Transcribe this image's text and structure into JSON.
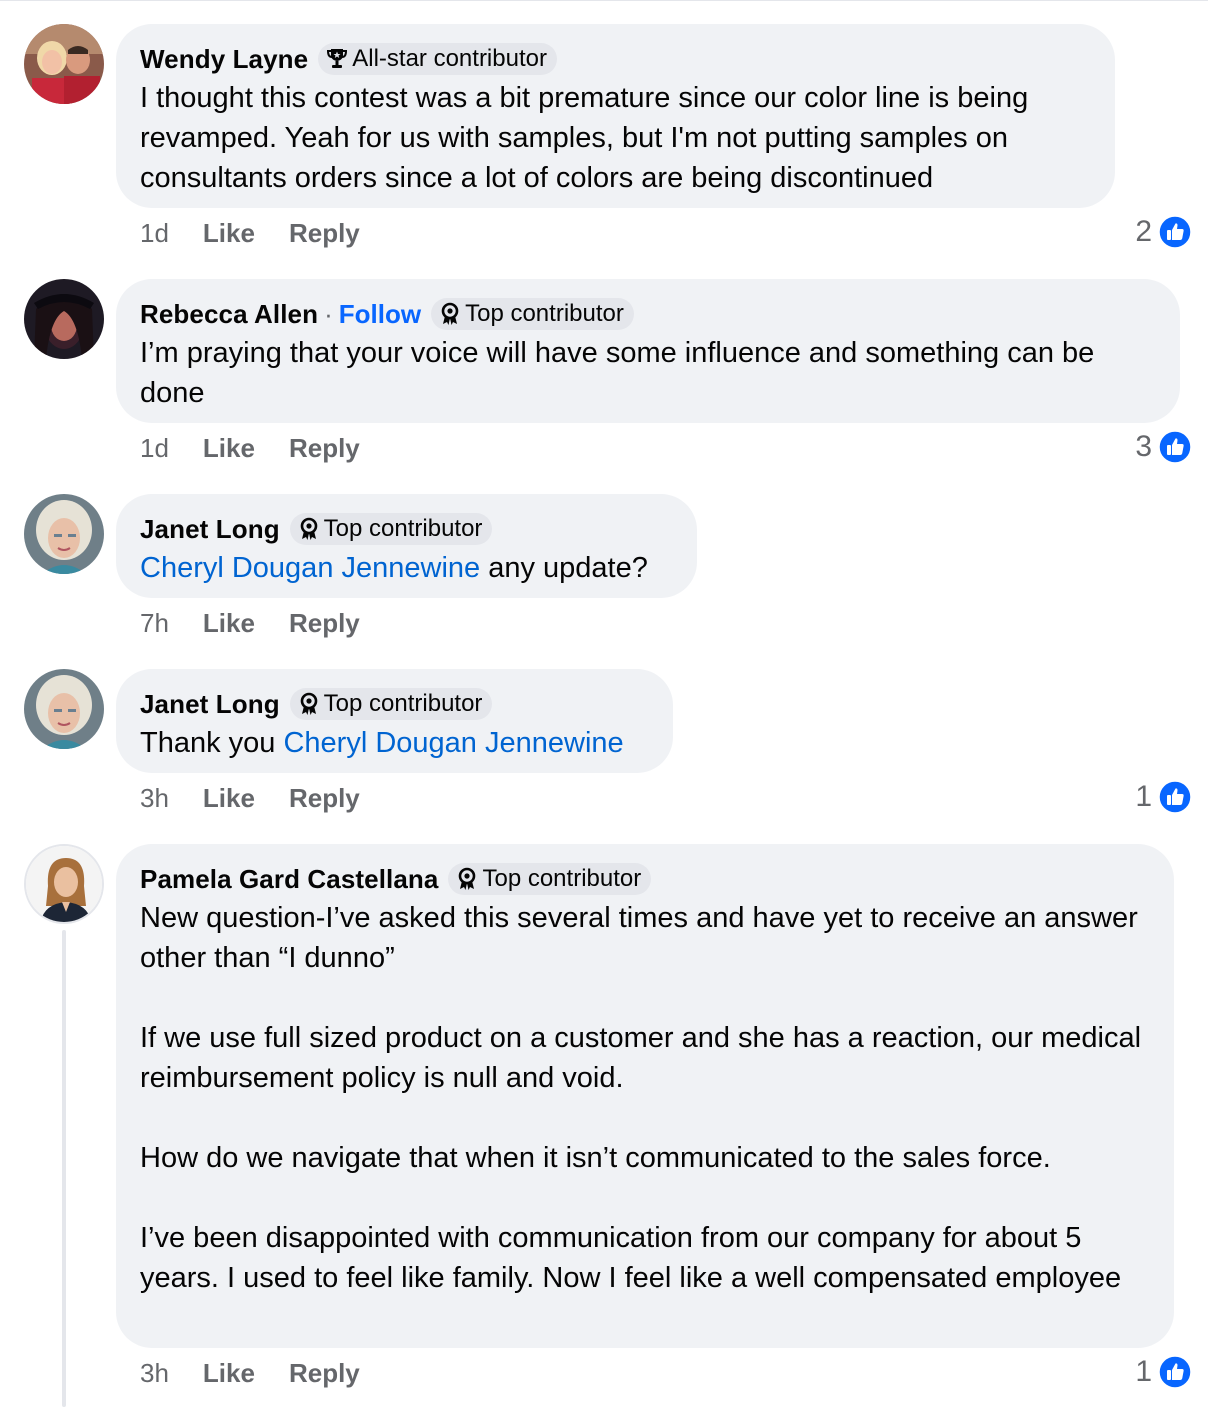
{
  "comments": [
    {
      "author": "Wendy Layne",
      "badge": "All-star contributor",
      "badge_icon": "trophy-icon",
      "text": [
        "I thought this contest was a bit premature since our color line is being revamped. Yeah for us with samples, but I'm not putting samples on consultants orders since a lot of colors are being discontinued"
      ],
      "time": "1d",
      "like_label": "Like",
      "reply_label": "Reply",
      "reaction_count": "2"
    },
    {
      "author": "Rebecca Allen",
      "separator": "·",
      "follow_label": "Follow",
      "badge": "Top contributor",
      "badge_icon": "ribbon-icon",
      "text": [
        "I’m praying that your voice will have some influence and something can be done"
      ],
      "time": "1d",
      "like_label": "Like",
      "reply_label": "Reply",
      "reaction_count": "3"
    },
    {
      "author": "Janet Long",
      "badge": "Top contributor",
      "badge_icon": "ribbon-icon",
      "mention": "Cheryl Dougan Jennewine",
      "text_after": " any update?",
      "time": "7h",
      "like_label": "Like",
      "reply_label": "Reply"
    },
    {
      "author": "Janet Long",
      "badge": "Top contributor",
      "badge_icon": "ribbon-icon",
      "text_before": "Thank you ",
      "mention": "Cheryl Dougan Jennewine",
      "time": "3h",
      "like_label": "Like",
      "reply_label": "Reply",
      "reaction_count": "1"
    },
    {
      "author": "Pamela Gard Castellana",
      "badge": "Top contributor",
      "badge_icon": "ribbon-icon",
      "paragraphs": [
        "New question-I’ve asked this several times and have yet to receive an answer other than “I dunno”",
        "If we use full sized product on a customer and she has a reaction, our medical reimbursement policy is null and void.",
        "How do we navigate that when it isn’t communicated to the sales force.",
        "I’ve been disappointed with communication from our company for about 5 years. I used to feel like family. Now I feel like a well compensated employee"
      ],
      "time": "3h",
      "like_label": "Like",
      "reply_label": "Reply",
      "reaction_count": "1"
    }
  ],
  "colors": {
    "bubble": "#f0f2f5",
    "link_blue": "#0866ff",
    "mention_blue": "#0064d1",
    "meta_gray": "#65676b",
    "like_blue": "#0866ff"
  }
}
